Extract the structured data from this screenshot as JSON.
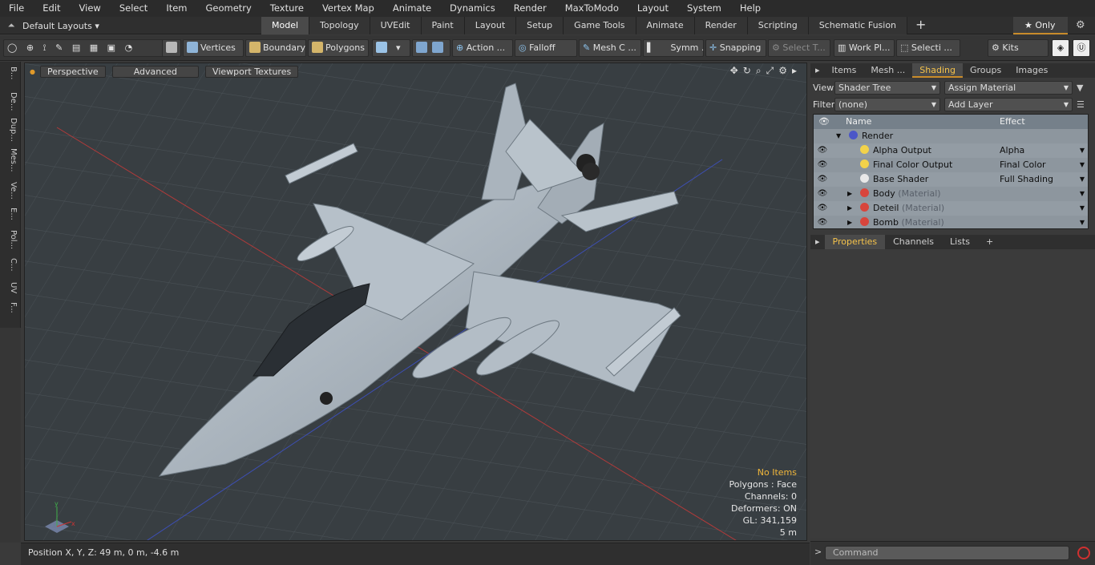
{
  "menu": [
    "File",
    "Edit",
    "View",
    "Select",
    "Item",
    "Geometry",
    "Texture",
    "Vertex Map",
    "Animate",
    "Dynamics",
    "Render",
    "MaxToModo",
    "Layout",
    "System",
    "Help"
  ],
  "layouts": {
    "label": "Default Layouts"
  },
  "tabs": [
    "Model",
    "Topology",
    "UVEdit",
    "Paint",
    "Layout",
    "Setup",
    "Game Tools",
    "Animate",
    "Render",
    "Scripting",
    "Schematic Fusion"
  ],
  "only_label": "Only",
  "toolbar": {
    "vertices": "Vertices",
    "boundary": "Boundary",
    "polygons": "Polygons",
    "action": "Action",
    "falloff": "Falloff",
    "meshc": "Mesh C ...",
    "symm": "Symm ...",
    "snapping": "Snapping",
    "selectt": "Select T...",
    "workpl": "Work Pl...",
    "selecti": "Selecti ...",
    "kits": "Kits"
  },
  "left_tabs": [
    "B...",
    "De...",
    "Dup...",
    "Mes...",
    "Ve...",
    "E...",
    "Pol...",
    "C...",
    "UV",
    "F..."
  ],
  "viewport": {
    "perspective": "Perspective",
    "advanced": "Advanced",
    "textures": "Viewport Textures",
    "hud": {
      "no_items": "No Items",
      "polygons": "Polygons : Face",
      "channels": "Channels: 0",
      "deformers": "Deformers: ON",
      "gl": "GL: 341,159",
      "scale": "5 m"
    }
  },
  "status": {
    "position": "Position X, Y, Z:   49 m, 0 m, -4.6 m"
  },
  "right": {
    "tabs": [
      "Items",
      "Mesh ...",
      "Shading",
      "Groups",
      "Images"
    ],
    "view_label": "View",
    "view_value": "Shader Tree",
    "assign": "Assign Material",
    "filter_label": "Filter",
    "filter_value": "(none)",
    "add_layer": "Add Layer",
    "col_name": "Name",
    "col_effect": "Effect",
    "rows": [
      {
        "name": "Render",
        "effect": "",
        "mat": ""
      },
      {
        "name": "Alpha Output",
        "effect": "Alpha",
        "mat": ""
      },
      {
        "name": "Final Color Output",
        "effect": "Final Color",
        "mat": ""
      },
      {
        "name": "Base Shader",
        "effect": "Full Shading",
        "mat": ""
      },
      {
        "name": "Body",
        "effect": "",
        "mat": "(Material)"
      },
      {
        "name": "Deteil",
        "effect": "",
        "mat": "(Material)"
      },
      {
        "name": "Bomb",
        "effect": "",
        "mat": "(Material)"
      }
    ],
    "ptabs": [
      "Properties",
      "Channels",
      "Lists"
    ],
    "command_placeholder": "Command"
  }
}
